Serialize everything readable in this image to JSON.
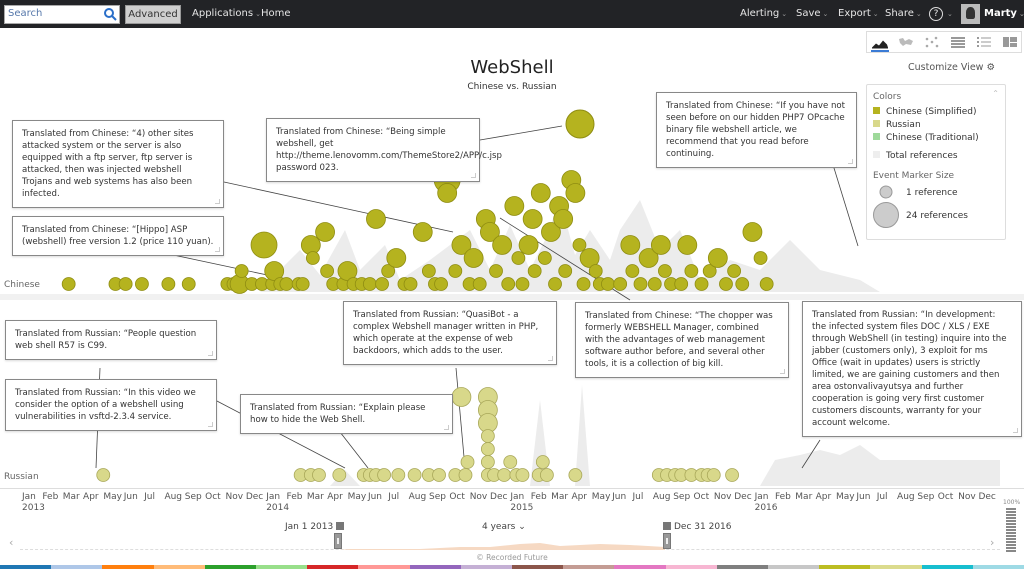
{
  "topbar": {
    "search_placeholder": "Search",
    "advanced_label": "Advanced",
    "applications_label": "Applications",
    "home_label": "Home",
    "alerting_label": "Alerting",
    "save_label": "Save",
    "export_label": "Export",
    "share_label": "Share",
    "help_label": "?",
    "user_name": "Marty"
  },
  "view_switcher": [
    "timeline-view",
    "map-view",
    "network-view",
    "table-view",
    "list-view",
    "grid-view"
  ],
  "customize_label": "Customize View",
  "page": {
    "title": "WebShell",
    "subtitle": "Chinese vs. Russian"
  },
  "legend": {
    "colors_heading": "Colors",
    "items": [
      {
        "label": "Chinese (Simplified)",
        "color": "#b5b31f"
      },
      {
        "label": "Russian",
        "color": "#d8d88a"
      },
      {
        "label": "Chinese (Traditional)",
        "color": "#9ed99a"
      },
      {
        "label": "Total references",
        "color": "#eeeeee"
      }
    ],
    "size_heading": "Event Marker Size",
    "size_small": "1 reference",
    "size_large": "24 references"
  },
  "lanes": {
    "chinese": "Chinese",
    "russian": "Russian"
  },
  "notes": {
    "cn1": "Translated from Chinese: “4) other sites attacked system or the server is also equipped with a ftp server, ftp server is attacked, then was injected webshell Trojans and web systems has also been infected.",
    "cn2": "Translated from Chinese: “[Hippo] ASP (webshell) free version 1.2 (price 110 yuan).",
    "cn3": "Translated from Chinese: “Being simple webshell, get http://theme.lenovomm.com/ThemeStore2/APP/c.jsp password 023.",
    "cn4": "Translated from Chinese: “If you have not seen before on our hidden PHP7 OPcache binary file webshell article, we recommend that you read before continuing.",
    "cn5": "Translated from Chinese: “The chopper was formerly WEBSHELL Manager, combined with the advantages of web management software author before, and several other tools, it is a collection of big kill.",
    "ru1": "Translated from Russian: “QuasiBot - a complex Webshell manager written in PHP, which operate at the expense of web backdoors, which adds to the user.",
    "ru2": "Translated from Russian: “In development: the infected system files DOC / XLS / EXE through WebShell (in testing) inquire into the jabber (customers only), 3 exploit for ms Office (wait in updates) users is strictly limited, we are gaining customers and then area ostonvalivayutsya and further cooperation is going very first customer customers discounts, warranty for your account welcome.",
    "ru3": "Translated from Russian: “People question web shell R57 is C99.",
    "ru4": "Translated from Russian: “In this video we consider the option of a webshell using vulnerabilities in vsftd-2.3.4 service.",
    "ru5": "Translated from Russian: “Explain please how to hide the Web Shell."
  },
  "axis": {
    "months": [
      "Jan",
      "Feb",
      "Mar",
      "Apr",
      "May",
      "Jun",
      "Jul",
      "Aug",
      "Sep",
      "Oct",
      "Nov",
      "Dec"
    ],
    "years": [
      "2013",
      "2014",
      "2015",
      "2016"
    ]
  },
  "range": {
    "start": "Jan 1 2013",
    "span": "4 years",
    "end": "Dec 31 2016",
    "zoom_pct": "100%"
  },
  "footer": "© Recorded Future",
  "colors": {
    "chinese": "#b5b31f",
    "chinese_stroke": "#8f8d12",
    "russian": "#d8d88a",
    "russian_stroke": "#a9a85a",
    "total": "#ececec"
  },
  "events": {
    "chinese": [
      {
        "m": 1.9,
        "r": 1,
        "l": 0
      },
      {
        "m": 4.2,
        "r": 1,
        "l": 0
      },
      {
        "m": 4.7,
        "r": 1,
        "l": 0
      },
      {
        "m": 5.5,
        "r": 1,
        "l": 0
      },
      {
        "m": 6.8,
        "r": 1,
        "l": 0
      },
      {
        "m": 7.8,
        "r": 1,
        "l": 0
      },
      {
        "m": 9.7,
        "r": 1,
        "l": 0
      },
      {
        "m": 10.0,
        "r": 1,
        "l": 0
      },
      {
        "m": 10.3,
        "r": 2,
        "l": 0
      },
      {
        "m": 10.4,
        "r": 1,
        "l": 1
      },
      {
        "m": 10.9,
        "r": 1,
        "l": 0
      },
      {
        "m": 11.4,
        "r": 1,
        "l": 0
      },
      {
        "m": 11.5,
        "r": 3,
        "l": 3
      },
      {
        "m": 11.9,
        "r": 1,
        "l": 0
      },
      {
        "m": 12.0,
        "r": 2,
        "l": 1
      },
      {
        "m": 12.3,
        "r": 1,
        "l": 0
      },
      {
        "m": 12.6,
        "r": 1,
        "l": 0
      },
      {
        "m": 13.2,
        "r": 1,
        "l": 0
      },
      {
        "m": 13.4,
        "r": 1,
        "l": 0
      },
      {
        "m": 13.8,
        "r": 2,
        "l": 3
      },
      {
        "m": 13.9,
        "r": 1,
        "l": 2
      },
      {
        "m": 14.5,
        "r": 2,
        "l": 4
      },
      {
        "m": 14.6,
        "r": 1,
        "l": 1
      },
      {
        "m": 14.9,
        "r": 1,
        "l": 0
      },
      {
        "m": 15.4,
        "r": 1,
        "l": 0
      },
      {
        "m": 15.6,
        "r": 2,
        "l": 1
      },
      {
        "m": 15.9,
        "r": 1,
        "l": 0
      },
      {
        "m": 16.3,
        "r": 1,
        "l": 0
      },
      {
        "m": 16.7,
        "r": 1,
        "l": 0
      },
      {
        "m": 17.0,
        "r": 2,
        "l": 5
      },
      {
        "m": 17.3,
        "r": 1,
        "l": 0
      },
      {
        "m": 17.6,
        "r": 1,
        "l": 1
      },
      {
        "m": 18.0,
        "r": 2,
        "l": 2
      },
      {
        "m": 18.4,
        "r": 1,
        "l": 0
      },
      {
        "m": 18.7,
        "r": 1,
        "l": 0
      },
      {
        "m": 19.3,
        "r": 2,
        "l": 4
      },
      {
        "m": 19.6,
        "r": 1,
        "l": 1
      },
      {
        "m": 19.9,
        "r": 1,
        "l": 0
      },
      {
        "m": 20.2,
        "r": 1,
        "l": 0
      },
      {
        "m": 20.5,
        "r": 3,
        "l": 8
      },
      {
        "m": 20.5,
        "r": 2,
        "l": 7
      },
      {
        "m": 20.9,
        "r": 1,
        "l": 1
      },
      {
        "m": 21.2,
        "r": 2,
        "l": 3
      },
      {
        "m": 21.6,
        "r": 1,
        "l": 0
      },
      {
        "m": 21.8,
        "r": 2,
        "l": 2
      },
      {
        "m": 22.1,
        "r": 1,
        "l": 0
      },
      {
        "m": 22.4,
        "r": 2,
        "l": 5
      },
      {
        "m": 22.6,
        "r": 2,
        "l": 4
      },
      {
        "m": 22.9,
        "r": 1,
        "l": 1
      },
      {
        "m": 23.2,
        "r": 2,
        "l": 3
      },
      {
        "m": 23.5,
        "r": 1,
        "l": 0
      },
      {
        "m": 23.8,
        "r": 2,
        "l": 6
      },
      {
        "m": 24.0,
        "r": 1,
        "l": 2
      },
      {
        "m": 24.2,
        "r": 1,
        "l": 0
      },
      {
        "m": 24.5,
        "r": 2,
        "l": 3
      },
      {
        "m": 24.7,
        "r": 2,
        "l": 5
      },
      {
        "m": 24.8,
        "r": 1,
        "l": 1
      },
      {
        "m": 25.1,
        "r": 2,
        "l": 7
      },
      {
        "m": 25.3,
        "r": 1,
        "l": 2
      },
      {
        "m": 25.6,
        "r": 2,
        "l": 4
      },
      {
        "m": 25.8,
        "r": 1,
        "l": 0
      },
      {
        "m": 26.0,
        "r": 2,
        "l": 6
      },
      {
        "m": 26.2,
        "r": 2,
        "l": 5
      },
      {
        "m": 26.3,
        "r": 1,
        "l": 1
      },
      {
        "m": 26.6,
        "r": 2,
        "l": 8
      },
      {
        "m": 26.8,
        "r": 2,
        "l": 7
      },
      {
        "m": 27.0,
        "r": 1,
        "l": 3
      },
      {
        "m": 27.2,
        "r": 1,
        "l": 0
      },
      {
        "m": 27.5,
        "r": 2,
        "l": 2
      },
      {
        "m": 27.8,
        "r": 1,
        "l": 1
      },
      {
        "m": 28.0,
        "r": 1,
        "l": 0
      },
      {
        "m": 28.4,
        "r": 1,
        "l": 0
      },
      {
        "m": 29.0,
        "r": 1,
        "l": 0
      },
      {
        "m": 29.5,
        "r": 2,
        "l": 3
      },
      {
        "m": 29.6,
        "r": 1,
        "l": 1
      },
      {
        "m": 30.0,
        "r": 1,
        "l": 0
      },
      {
        "m": 30.4,
        "r": 2,
        "l": 2
      },
      {
        "m": 30.7,
        "r": 1,
        "l": 0
      },
      {
        "m": 31.0,
        "r": 2,
        "l": 3
      },
      {
        "m": 31.2,
        "r": 1,
        "l": 1
      },
      {
        "m": 31.5,
        "r": 1,
        "l": 0
      },
      {
        "m": 32.0,
        "r": 1,
        "l": 0
      },
      {
        "m": 32.3,
        "r": 2,
        "l": 3
      },
      {
        "m": 32.5,
        "r": 1,
        "l": 1
      },
      {
        "m": 33.0,
        "r": 1,
        "l": 0
      },
      {
        "m": 33.4,
        "r": 1,
        "l": 1
      },
      {
        "m": 33.8,
        "r": 2,
        "l": 2
      },
      {
        "m": 34.2,
        "r": 1,
        "l": 0
      },
      {
        "m": 34.6,
        "r": 1,
        "l": 1
      },
      {
        "m": 35.0,
        "r": 1,
        "l": 0
      },
      {
        "m": 35.5,
        "r": 2,
        "l": 4
      },
      {
        "m": 35.9,
        "r": 1,
        "l": 2
      },
      {
        "m": 36.2,
        "r": 1,
        "l": 0
      }
    ],
    "russian": [
      {
        "m": 3.6,
        "r": 1,
        "l": 0
      },
      {
        "m": 13.3,
        "r": 1,
        "l": 0
      },
      {
        "m": 13.8,
        "r": 1,
        "l": 0
      },
      {
        "m": 14.2,
        "r": 1,
        "l": 0
      },
      {
        "m": 15.2,
        "r": 1,
        "l": 0
      },
      {
        "m": 16.4,
        "r": 1,
        "l": 0
      },
      {
        "m": 16.7,
        "r": 1,
        "l": 0
      },
      {
        "m": 17.0,
        "r": 1,
        "l": 0
      },
      {
        "m": 17.4,
        "r": 1,
        "l": 0
      },
      {
        "m": 18.1,
        "r": 1,
        "l": 0
      },
      {
        "m": 18.9,
        "r": 1,
        "l": 0
      },
      {
        "m": 19.6,
        "r": 1,
        "l": 0
      },
      {
        "m": 20.1,
        "r": 1,
        "l": 0
      },
      {
        "m": 20.9,
        "r": 1,
        "l": 0
      },
      {
        "m": 21.4,
        "r": 1,
        "l": 0
      },
      {
        "m": 21.2,
        "r": 2,
        "l": 6
      },
      {
        "m": 21.5,
        "r": 1,
        "l": 1
      },
      {
        "m": 22.5,
        "r": 2,
        "l": 6
      },
      {
        "m": 22.5,
        "r": 2,
        "l": 5
      },
      {
        "m": 22.5,
        "r": 2,
        "l": 4
      },
      {
        "m": 22.5,
        "r": 1,
        "l": 3
      },
      {
        "m": 22.5,
        "r": 1,
        "l": 2
      },
      {
        "m": 22.5,
        "r": 1,
        "l": 1
      },
      {
        "m": 22.5,
        "r": 1,
        "l": 0
      },
      {
        "m": 22.8,
        "r": 1,
        "l": 0
      },
      {
        "m": 23.3,
        "r": 1,
        "l": 0
      },
      {
        "m": 23.6,
        "r": 1,
        "l": 1
      },
      {
        "m": 23.9,
        "r": 1,
        "l": 0
      },
      {
        "m": 24.2,
        "r": 1,
        "l": 0
      },
      {
        "m": 25.0,
        "r": 1,
        "l": 0
      },
      {
        "m": 25.2,
        "r": 1,
        "l": 1
      },
      {
        "m": 25.4,
        "r": 1,
        "l": 0
      },
      {
        "m": 26.8,
        "r": 1,
        "l": 0
      },
      {
        "m": 30.9,
        "r": 1,
        "l": 0
      },
      {
        "m": 31.3,
        "r": 1,
        "l": 0
      },
      {
        "m": 31.7,
        "r": 1,
        "l": 0
      },
      {
        "m": 32.0,
        "r": 1,
        "l": 0
      },
      {
        "m": 32.5,
        "r": 1,
        "l": 0
      },
      {
        "m": 33.0,
        "r": 1,
        "l": 0
      },
      {
        "m": 33.3,
        "r": 1,
        "l": 0
      },
      {
        "m": 33.6,
        "r": 1,
        "l": 0
      },
      {
        "m": 34.5,
        "r": 1,
        "l": 0
      }
    ]
  }
}
